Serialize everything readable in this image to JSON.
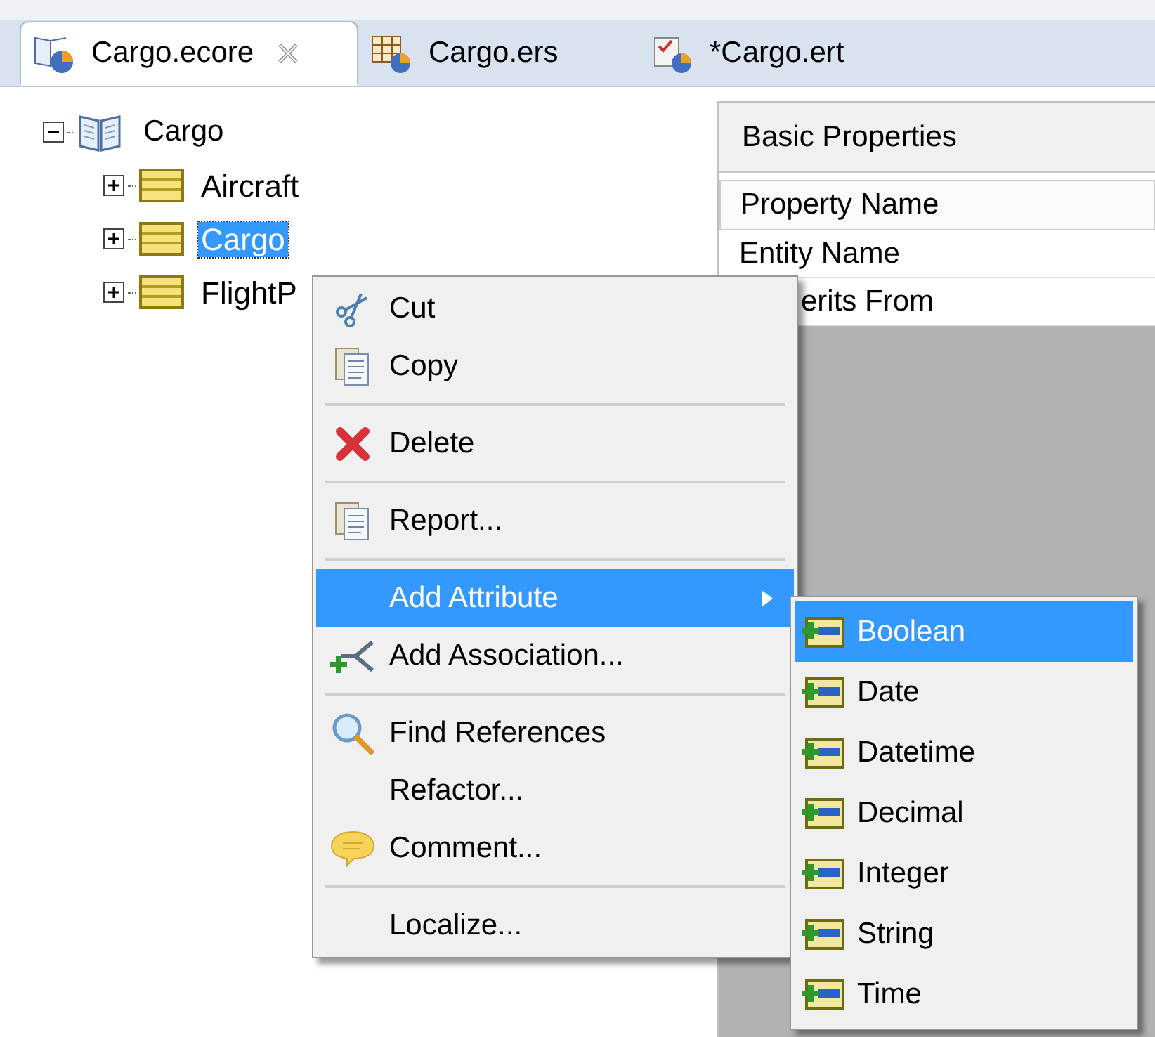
{
  "tabs": [
    {
      "label": "Cargo.ecore",
      "selected": true
    },
    {
      "label": "Cargo.ers",
      "selected": false
    },
    {
      "label": "*Cargo.ert",
      "selected": false
    }
  ],
  "tree": {
    "label": "Cargo",
    "expanded": true,
    "selected": false,
    "children": [
      {
        "label": "Aircraft",
        "expanded": false,
        "selected": false
      },
      {
        "label": "Cargo",
        "expanded": false,
        "selected": true
      },
      {
        "label": "FlightP",
        "expanded": false,
        "selected": false
      }
    ]
  },
  "properties": {
    "title": "Basic Properties",
    "header": "Property Name",
    "rows": [
      "Entity Name",
      "erits From"
    ]
  },
  "context_menu": {
    "groups": [
      [
        {
          "label": "Cut",
          "selected": false,
          "has_submenu": false
        },
        {
          "label": "Copy",
          "selected": false,
          "has_submenu": false
        }
      ],
      [
        {
          "label": "Delete",
          "selected": false,
          "has_submenu": false
        }
      ],
      [
        {
          "label": "Report...",
          "selected": false,
          "has_submenu": false
        }
      ],
      [
        {
          "label": "Add Attribute",
          "selected": true,
          "has_submenu": true
        },
        {
          "label": "Add Association...",
          "selected": false,
          "has_submenu": false
        }
      ],
      [
        {
          "label": "Find References",
          "selected": false,
          "has_submenu": false
        },
        {
          "label": "Refactor...",
          "selected": false,
          "has_submenu": false
        },
        {
          "label": "Comment...",
          "selected": false,
          "has_submenu": false
        }
      ],
      [
        {
          "label": "Localize...",
          "selected": false,
          "has_submenu": false
        }
      ]
    ]
  },
  "submenu": {
    "items": [
      {
        "label": "Boolean",
        "selected": true
      },
      {
        "label": "Date",
        "selected": false
      },
      {
        "label": "Datetime",
        "selected": false
      },
      {
        "label": "Decimal",
        "selected": false
      },
      {
        "label": "Integer",
        "selected": false
      },
      {
        "label": "String",
        "selected": false
      },
      {
        "label": "Time",
        "selected": false
      }
    ]
  }
}
